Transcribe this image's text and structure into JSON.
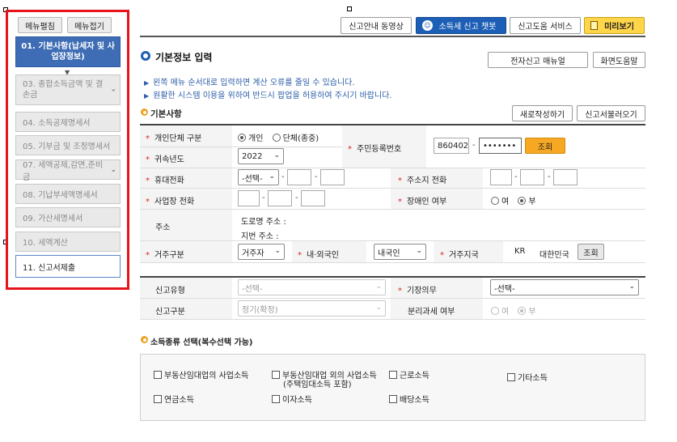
{
  "sidebar": {
    "expand_label": "메뉴펼침",
    "collapse_label": "메뉴접기",
    "items": [
      {
        "label": "01. 기본사항(납세자 및 사업장정보)"
      },
      {
        "label": "03. 종합소득금액 및 결손금"
      },
      {
        "label": "04. 소득공제명세서"
      },
      {
        "label": "05. 기부금 및 조정명세서"
      },
      {
        "label": "07. 세액공제,감면,준비금"
      },
      {
        "label": "08. 기납부세액명세서"
      },
      {
        "label": "09. 가산세명세서"
      },
      {
        "label": "10. 세액계산"
      },
      {
        "label": "11. 신고서제출"
      }
    ]
  },
  "topbar": {
    "video_guide": "신고안내 동영상",
    "chatbot": "소득세 신고 챗봇",
    "help_service": "신고도움 서비스",
    "preview": "미리보기"
  },
  "page": {
    "title": "기본정보 입력",
    "manual_button": "전자신고 매뉴얼",
    "screen_help_button": "화면도움말",
    "notice1": "왼쪽 메뉴 순서대로 입력하면 계산 오류를 줄일 수 있습니다.",
    "notice2": "원활한 시스템 이용을 위하여 반드시 팝업을 허용하여 주시기 바랍니다."
  },
  "basic": {
    "section_title": "기본사항",
    "new_button": "새로작성하기",
    "load_button": "신고서불러오기",
    "person_type_label": "개인단체 구분",
    "person_option": "개인",
    "group_option": "단체(종중)",
    "person_selected": "개인",
    "year_label": "귀속년도",
    "year_value": "2022",
    "rrn_label": "주민등록번호",
    "rrn_front": "860402",
    "rrn_back": "•••••••",
    "lookup_button": "조회",
    "mobile_label": "휴대전화",
    "mobile_select": "-선택-",
    "home_phone_label": "주소지 전화",
    "biz_phone_label": "사업장 전화",
    "disabled_label": "장애인 여부",
    "yes_option": "여",
    "no_option": "부",
    "disabled_selected": "부",
    "address_label": "주소",
    "road_address": "도로명 주소 :",
    "lot_address": "지번 주소 :",
    "residence_label": "거주구분",
    "residence_value": "거주자",
    "nationality_label": "내·외국인",
    "nationality_value": "내국인",
    "country_label": "거주지국",
    "country_code": "KR",
    "country_name": "대한민국",
    "country_lookup": "조회",
    "report_type_label": "신고유형",
    "report_type_value": "-선택-",
    "bookkeeping_label": "기장의무",
    "bookkeeping_value": "-선택-",
    "report_kind_label": "신고구분",
    "report_kind_value": "정기(확정)",
    "separate_tax_label": "분리과세 여부",
    "separate_selected": "부"
  },
  "income": {
    "section_title": "소득종류 선택(복수선택 가능)",
    "options": [
      {
        "label": "부동산임대업의 사업소득"
      },
      {
        "label": "부동산임대업 외의 사업소득",
        "sub": "(주택임대소득 포함)"
      },
      {
        "label": "근로소득"
      },
      {
        "label": "기타소득"
      },
      {
        "label": "연금소득"
      },
      {
        "label": "이자소득"
      },
      {
        "label": "배당소득"
      }
    ]
  },
  "colors": {
    "accent_blue": "#1d5fb6",
    "highlight_red": "#e8141b",
    "lookup_orange": "#f7a823",
    "preview_yellow": "#ffd54a"
  }
}
